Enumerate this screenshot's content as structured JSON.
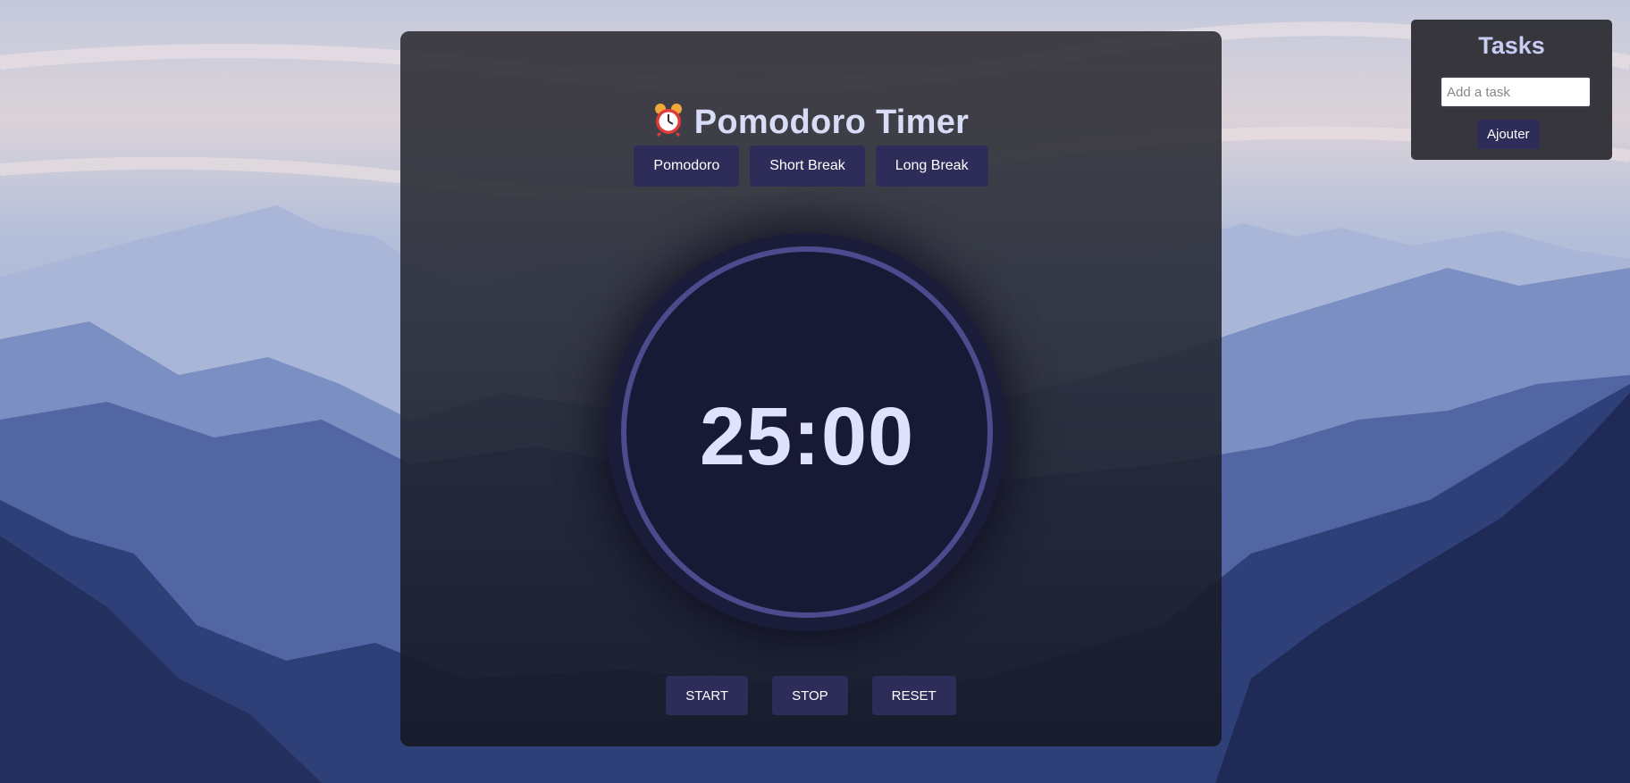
{
  "app": {
    "title": "Pomodoro Timer",
    "title_icon": "alarm-clock-icon"
  },
  "modes": [
    {
      "label": "Pomodoro"
    },
    {
      "label": "Short Break"
    },
    {
      "label": "Long Break"
    }
  ],
  "timer": {
    "display": "25:00"
  },
  "controls": {
    "start_label": "START",
    "stop_label": "STOP",
    "reset_label": "RESET"
  },
  "tasks": {
    "title": "Tasks",
    "input_placeholder": "Add a task",
    "input_value": "",
    "add_label": "Ajouter"
  },
  "colors": {
    "button_bg": "#2e2d5a",
    "ring": "#4b4b8e",
    "title_text": "#d9dcf7"
  }
}
